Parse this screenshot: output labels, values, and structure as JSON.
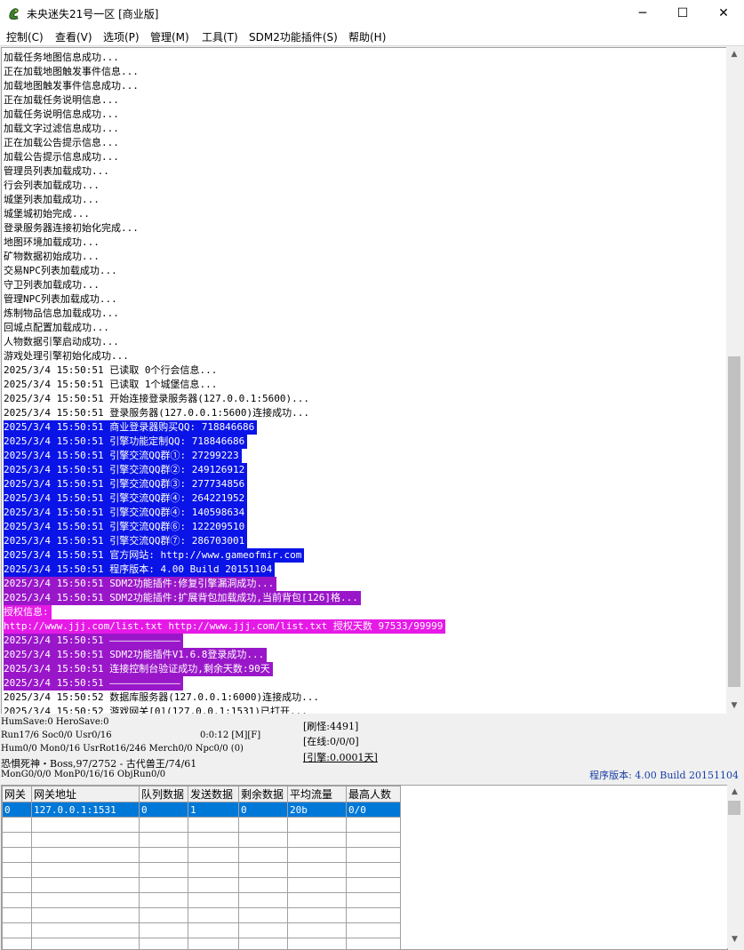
{
  "window": {
    "title": "未央迷失21号一区 [商业版]",
    "app_icon": "dragon-app-icon",
    "min_glyph": "─",
    "max_glyph": "☐",
    "close_glyph": "✕"
  },
  "menu": [
    {
      "label": "控制(C)"
    },
    {
      "label": "查看(V)"
    },
    {
      "label": "选项(P)"
    },
    {
      "label": "管理(M)"
    },
    {
      "label": "工具(T)"
    },
    {
      "label": "SDM2功能插件(S)"
    },
    {
      "label": "帮助(H)"
    }
  ],
  "log": {
    "lines": [
      {
        "text": "加载任务地图信息成功...",
        "bg": "",
        "fg": "#000000"
      },
      {
        "text": "正在加载地图触发事件信息...",
        "bg": "",
        "fg": "#000000"
      },
      {
        "text": "加载地图触发事件信息成功...",
        "bg": "",
        "fg": "#000000"
      },
      {
        "text": "正在加载任务说明信息...",
        "bg": "",
        "fg": "#000000"
      },
      {
        "text": "加载任务说明信息成功...",
        "bg": "",
        "fg": "#000000"
      },
      {
        "text": "加载文字过滤信息成功...",
        "bg": "",
        "fg": "#000000"
      },
      {
        "text": "正在加载公告提示信息...",
        "bg": "",
        "fg": "#000000"
      },
      {
        "text": "加载公告提示信息成功...",
        "bg": "",
        "fg": "#000000"
      },
      {
        "text": "管理员列表加载成功...",
        "bg": "",
        "fg": "#000000"
      },
      {
        "text": "行会列表加载成功...",
        "bg": "",
        "fg": "#000000"
      },
      {
        "text": "城堡列表加载成功...",
        "bg": "",
        "fg": "#000000"
      },
      {
        "text": "城堡城初始完成...",
        "bg": "",
        "fg": "#000000"
      },
      {
        "text": "登录服务器连接初始化完成...",
        "bg": "",
        "fg": "#000000"
      },
      {
        "text": "地图环境加载成功...",
        "bg": "",
        "fg": "#000000"
      },
      {
        "text": "矿物数据初始成功...",
        "bg": "",
        "fg": "#000000"
      },
      {
        "text": "交易NPC列表加载成功...",
        "bg": "",
        "fg": "#000000"
      },
      {
        "text": "守卫列表加载成功...",
        "bg": "",
        "fg": "#000000"
      },
      {
        "text": "管理NPC列表加载成功...",
        "bg": "",
        "fg": "#000000"
      },
      {
        "text": "炼制物品信息加载成功...",
        "bg": "",
        "fg": "#000000"
      },
      {
        "text": "回城点配置加载成功...",
        "bg": "",
        "fg": "#000000"
      },
      {
        "text": "人物数据引擎启动成功...",
        "bg": "",
        "fg": "#000000"
      },
      {
        "text": "游戏处理引擎初始化成功...",
        "bg": "",
        "fg": "#000000"
      },
      {
        "text": "2025/3/4 15:50:51 已读取 0个行会信息...",
        "bg": "",
        "fg": "#000000"
      },
      {
        "text": "2025/3/4 15:50:51 已读取 1个城堡信息...",
        "bg": "",
        "fg": "#000000"
      },
      {
        "text": "2025/3/4 15:50:51 开始连接登录服务器(127.0.0.1:5600)...",
        "bg": "",
        "fg": "#000000"
      },
      {
        "text": "2025/3/4 15:50:51 登录服务器(127.0.0.1:5600)连接成功...",
        "bg": "",
        "fg": "#000000"
      },
      {
        "text": "2025/3/4 15:50:51 商业登录器购买QQ: 718846686",
        "bg": "#0a14e6",
        "fg": "#ffffff"
      },
      {
        "text": "2025/3/4 15:50:51 引擎功能定制QQ: 718846686",
        "bg": "#0a14e6",
        "fg": "#ffffff"
      },
      {
        "text": "2025/3/4 15:50:51 引擎交流QQ群①: 27299223",
        "bg": "#0a14e6",
        "fg": "#ffffff"
      },
      {
        "text": "2025/3/4 15:50:51 引擎交流QQ群②: 249126912",
        "bg": "#0a14e6",
        "fg": "#ffffff"
      },
      {
        "text": "2025/3/4 15:50:51 引擎交流QQ群③: 277734856",
        "bg": "#0a14e6",
        "fg": "#ffffff"
      },
      {
        "text": "2025/3/4 15:50:51 引擎交流QQ群④: 264221952",
        "bg": "#0a14e6",
        "fg": "#ffffff"
      },
      {
        "text": "2025/3/4 15:50:51 引擎交流QQ群④: 140598634",
        "bg": "#0a14e6",
        "fg": "#ffffff"
      },
      {
        "text": "2025/3/4 15:50:51 引擎交流QQ群⑥: 122209510",
        "bg": "#0a14e6",
        "fg": "#ffffff"
      },
      {
        "text": "2025/3/4 15:50:51 引擎交流QQ群⑦: 286703001",
        "bg": "#0a14e6",
        "fg": "#ffffff"
      },
      {
        "text": "2025/3/4 15:50:51 官方网站: http://www.gameofmir.com",
        "bg": "#0a14e6",
        "fg": "#ffffff"
      },
      {
        "text": "2025/3/4 15:50:51 程序版本: 4.00 Build 20151104",
        "bg": "#0a14e6",
        "fg": "#ffffff"
      },
      {
        "text": "2025/3/4 15:50:51 SDM2功能插件:修复引擎漏洞成功...",
        "bg": "#9a17c9",
        "fg": "#ffffff"
      },
      {
        "text": "2025/3/4 15:50:51 SDM2功能插件:扩展背包加载成功,当前背包[126]格...",
        "bg": "#9a17c9",
        "fg": "#ffffff"
      },
      {
        "text": "授权信息:",
        "bg": "#e61ae6",
        "fg": "#ffffff"
      },
      {
        "text": "http://www.jjj.com/list.txt http://www.jjj.com/list.txt 授权天数 97533/99999",
        "bg": "#e61ae6",
        "fg": "#ffffff"
      },
      {
        "text": "2025/3/4 15:50:51 ————————————",
        "bg": "#9a17c9",
        "fg": "#ffffff"
      },
      {
        "text": "2025/3/4 15:50:51 SDM2功能插件V1.6.8登录成功...",
        "bg": "#9a17c9",
        "fg": "#ffffff"
      },
      {
        "text": "2025/3/4 15:50:51 连接控制台验证成功,剩余天数:90天",
        "bg": "#9a17c9",
        "fg": "#ffffff"
      },
      {
        "text": "2025/3/4 15:50:51 ————————————",
        "bg": "#9a17c9",
        "fg": "#ffffff"
      },
      {
        "text": "2025/3/4 15:50:52 数据库服务器(127.0.0.1:6000)连接成功...",
        "bg": "",
        "fg": "#000000"
      },
      {
        "text": "2025/3/4 15:50:52 游戏网关[0](127.0.0.1:1531)已打开...",
        "bg": "",
        "fg": "#000000"
      }
    ]
  },
  "status": {
    "line1": "HumSave:0 HeroSave:0",
    "line2": "Run17/6 Soc0/0 Usr0/16",
    "line2_time": "0:0:12 [M][F]",
    "line3": "Hum0/0 Mon0/16 UsrRot16/246 Merch0/0 Npc0/0 (0)",
    "line4": "恐惧死神・Boss,97/2752 - 古代兽王/74/61",
    "line5": "MonG0/0/0 MonP0/16/16 ObjRun0/0",
    "box1": "[刷怪:4491]",
    "box2": "[在线:0/0/0]",
    "box3": "[引擎:0.0001天]",
    "version": "程序版本: 4.00 Build 20151104"
  },
  "grid": {
    "headers": [
      "网关",
      "网关地址",
      "队列数据",
      "发送数据",
      "剩余数据",
      "平均流量",
      "最高人数"
    ],
    "rows": [
      [
        "0",
        "127.0.0.1:1531",
        "0",
        "1",
        "0",
        "20b",
        "0/0"
      ]
    ]
  }
}
